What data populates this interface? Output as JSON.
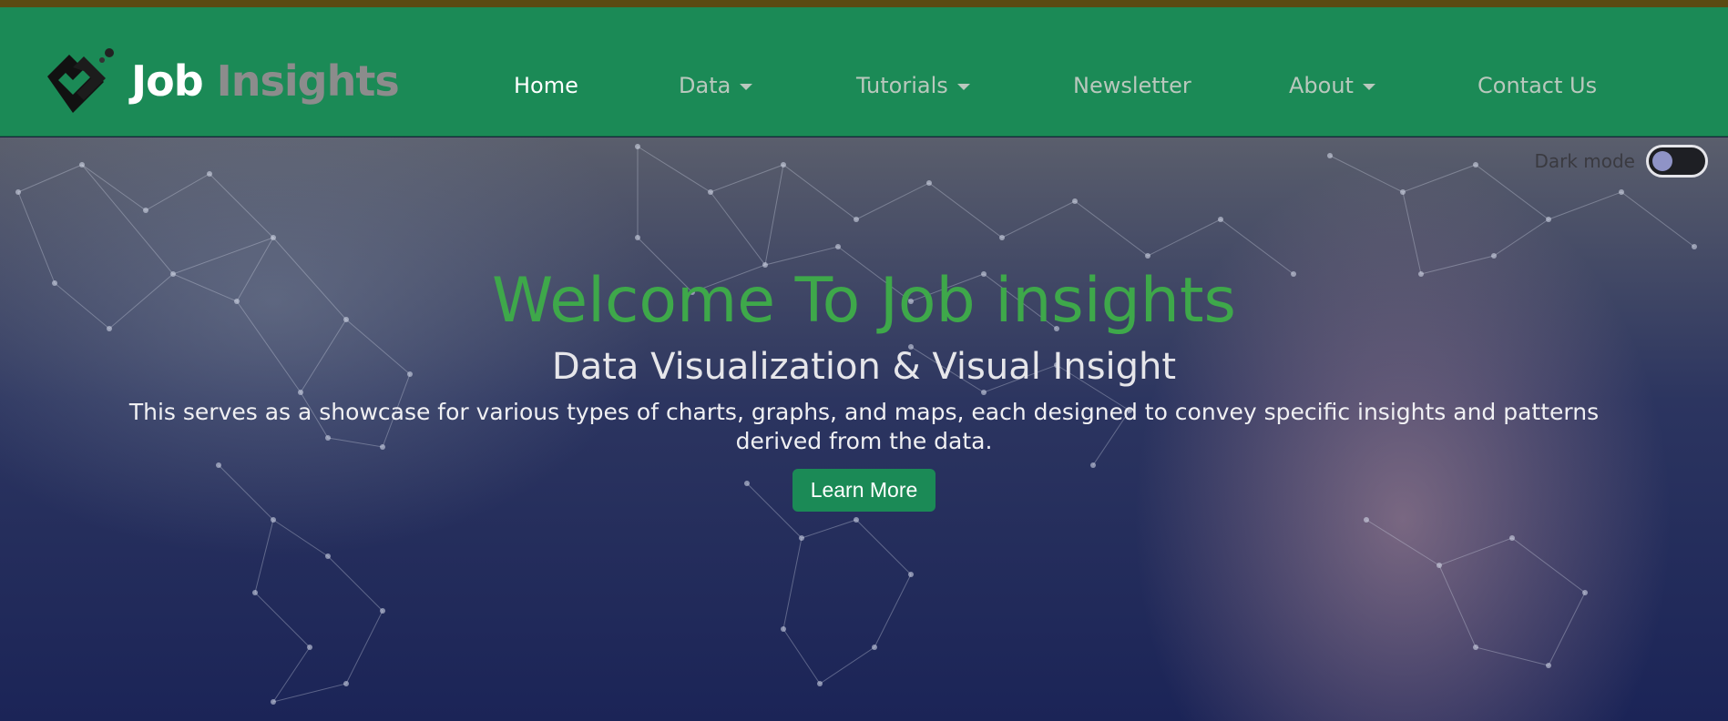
{
  "brand": {
    "part1": "Job",
    "part2": "Insights"
  },
  "nav": {
    "home": "Home",
    "data": "Data",
    "tutorials": "Tutorials",
    "newsletter": "Newsletter",
    "about": "About",
    "contact": "Contact Us"
  },
  "toggle": {
    "label": "Dark mode"
  },
  "hero": {
    "title": "Welcome To Job insights",
    "subtitle": "Data Visualization & Visual Insight",
    "description": "This serves as a showcase for various types of charts, graphs, and maps, each designed to convey specific insights and patterns derived from the data.",
    "button": "Learn More"
  },
  "colors": {
    "navbar": "#1b8a56",
    "title_green": "#3ea84a",
    "top_strip": "#5b4a12"
  }
}
